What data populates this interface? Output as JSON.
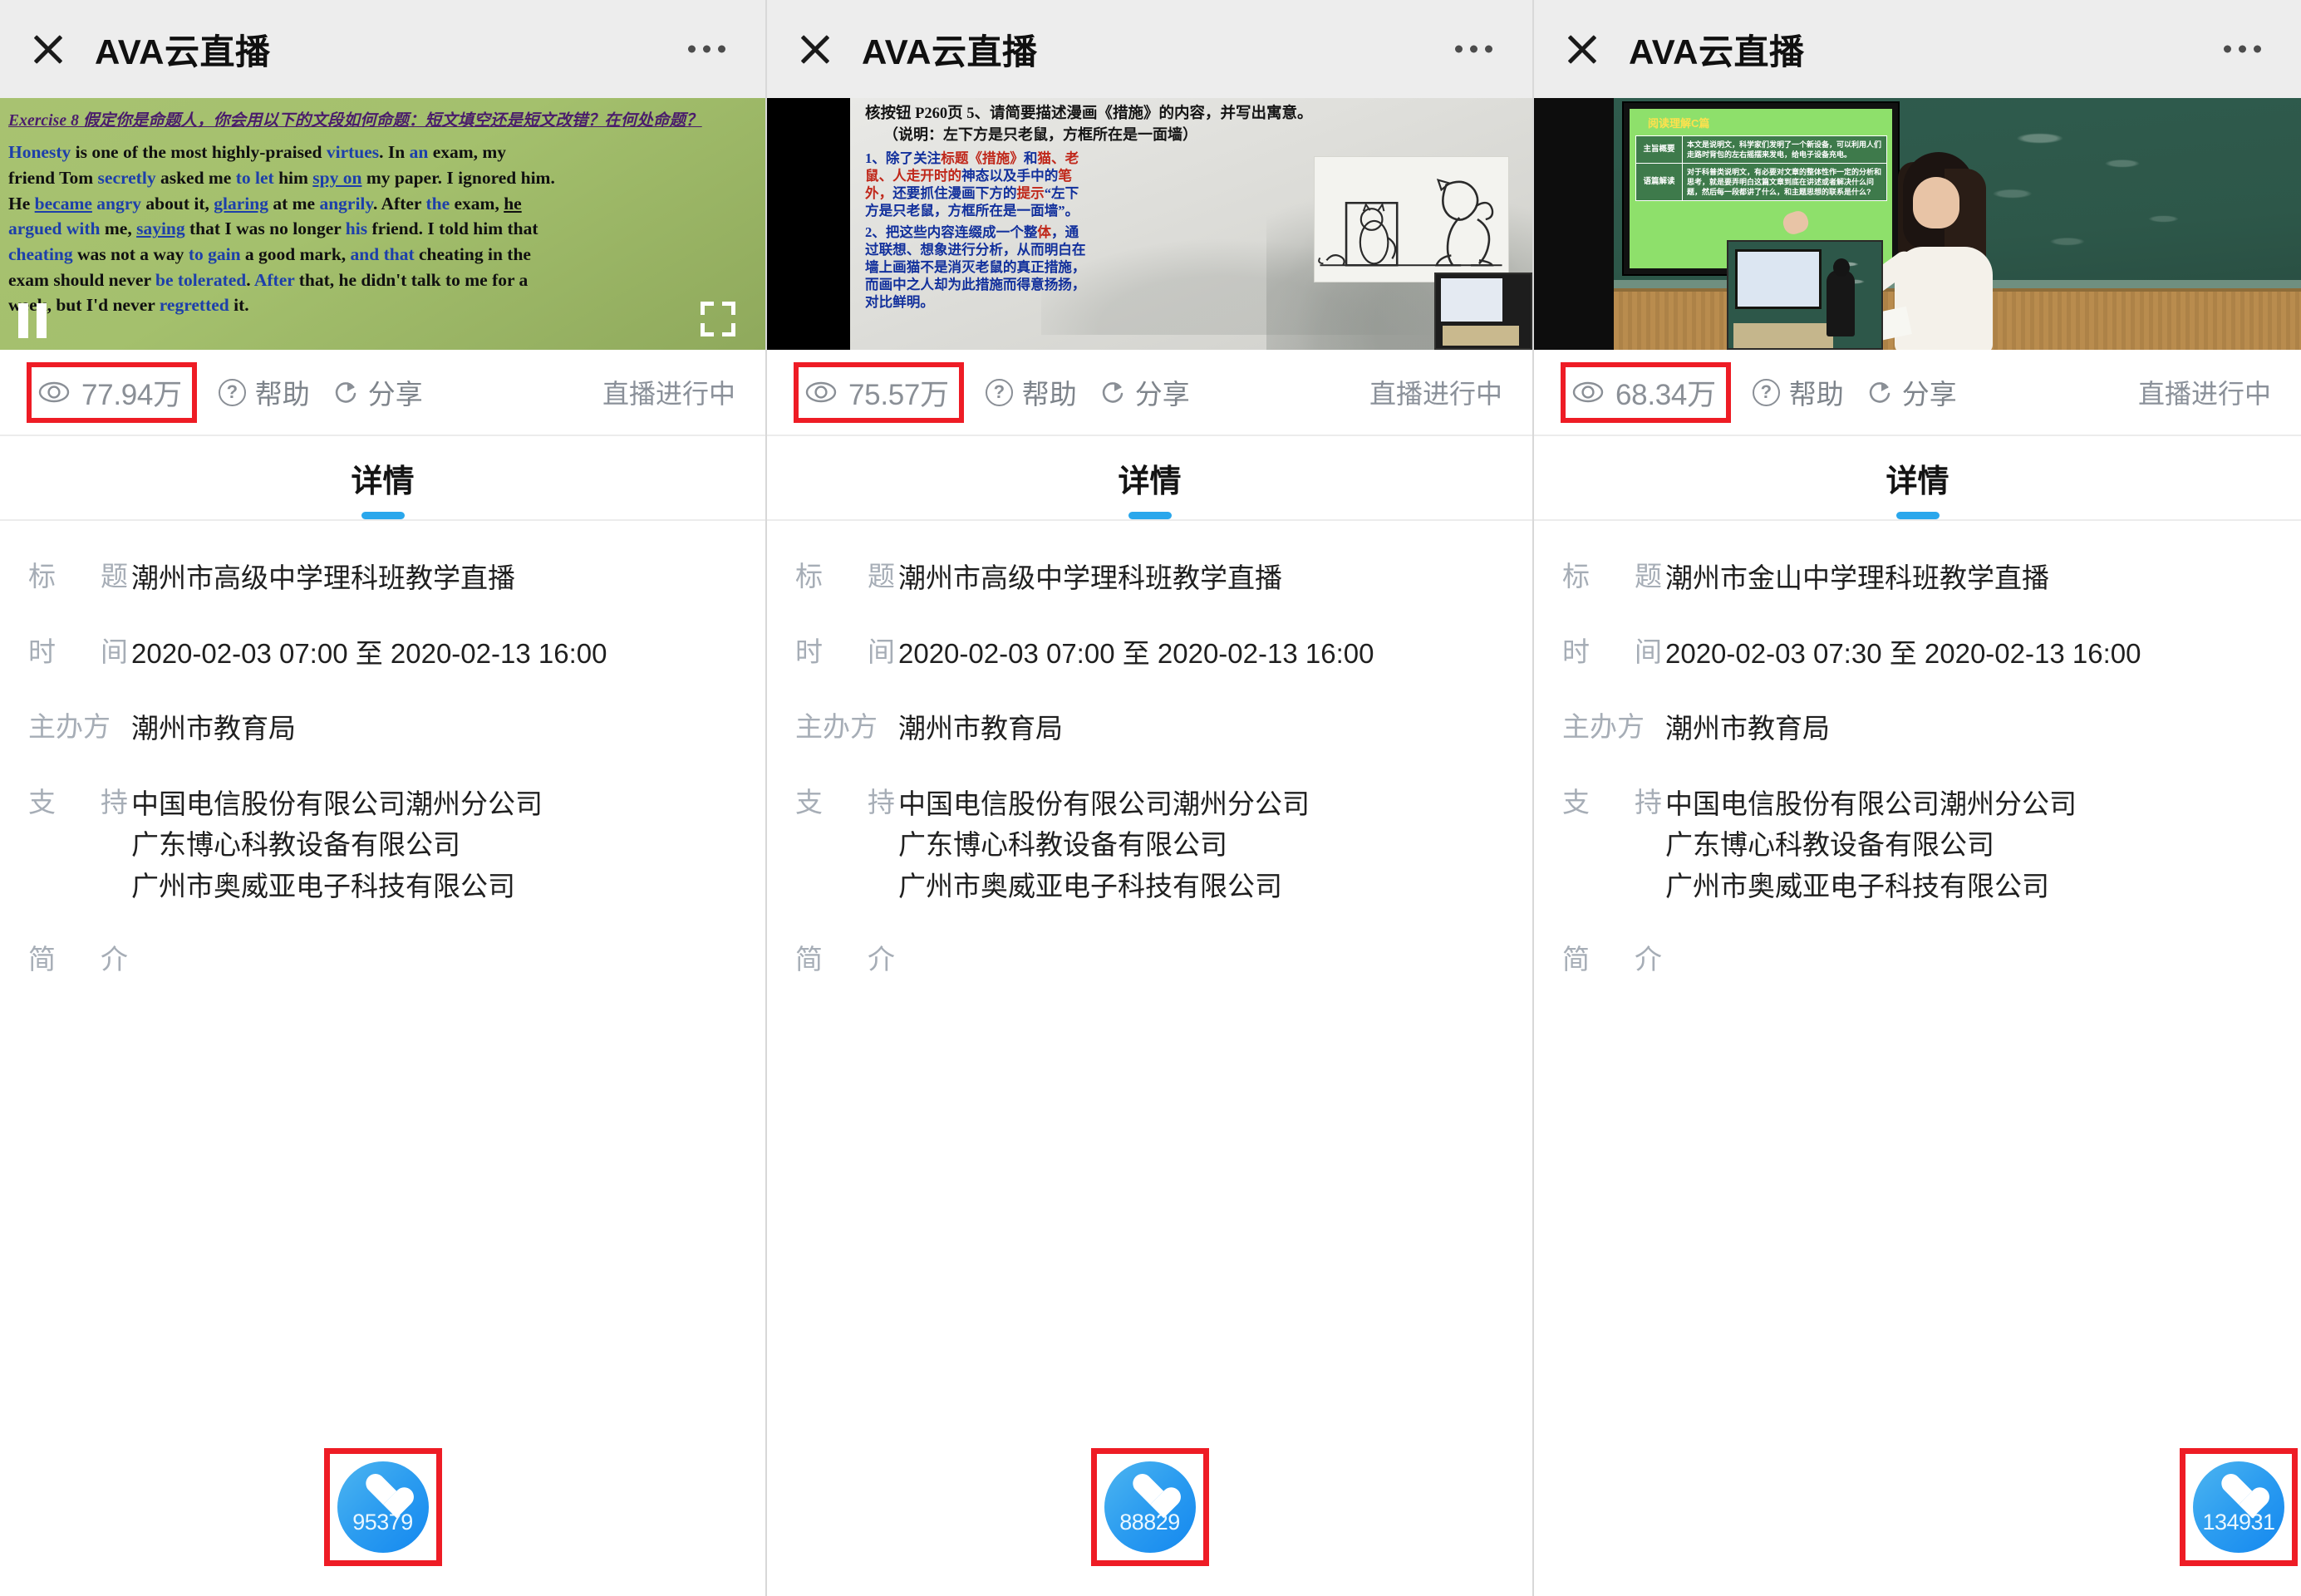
{
  "header": {
    "title": "AVA云直播",
    "close_icon": "close-icon",
    "more_icon": "more-options-icon"
  },
  "stats_common": {
    "help_label": "帮助",
    "share_label": "分享",
    "live_status": "直播进行中",
    "eye_icon": "eye-icon",
    "help_icon": "question-mark-icon",
    "share_icon": "share-icon"
  },
  "tab": {
    "label": "详情"
  },
  "info_keys": {
    "title": "标  题",
    "time": "时  间",
    "organizer": "主办方",
    "support": "支  持",
    "intro": "简  介"
  },
  "colors": {
    "accent_blue": "#2aa7ec",
    "highlight_red": "#ee1c25",
    "like_blue": "#2b9cf0",
    "muted_gray": "#a6adb6"
  },
  "panels": [
    {
      "views": "77.94万",
      "title": "潮州市高级中学理科班教学直播",
      "time": "2020-02-03 07:00 至 2020-02-13 16:00",
      "organizer": "潮州市教育局",
      "support": "中国电信股份有限公司潮州分公司\n广东博心科教设备有限公司\n广州市奥威亚电子科技有限公司",
      "intro": "",
      "like_count": "95379",
      "video": {
        "kind": "english-slide",
        "pause_icon": "pause-icon",
        "fullscreen_icon": "fullscreen-icon",
        "slide_heading": "Exercise 8  假定你是命题人，你会用以下的文段如何命题：短文填空还是短文改错？在何处命题？",
        "slide_lines": [
          "Honesty is one of the most highly-praised virtues. In an exam, my",
          "friend Tom secretly asked me to let him spy on my paper. I ignored him.",
          "He became angry about it, glaring at me angrily. After the exam, he",
          "argued with me, saying that I was no longer his friend. I told him that",
          "cheating was not a way to gain a good mark, and that cheating in the",
          "exam should never be tolerated. After that, he didn't talk to me for a",
          "week, but I'd never regretted it."
        ]
      }
    },
    {
      "views": "75.57万",
      "title": "潮州市高级中学理科班教学直播",
      "time": "2020-02-03 07:00 至 2020-02-13 16:00",
      "organizer": "潮州市教育局",
      "support": "中国电信股份有限公司潮州分公司\n广东博心科教设备有限公司\n广州市奥威亚电子科技有限公司",
      "intro": "",
      "like_count": "88829",
      "video": {
        "kind": "chinese-slide",
        "q_line1": "核按钮 P260页 5、请简要描述漫画《措施》的内容，并写出寓意。",
        "q_line2": "（说明：左下方是只老鼠，方框所在是一面墙）",
        "point1": "1、除了关注标题《措施》和猫、老鼠、人走开时的神态以及手中的笔外，还要抓住漫画下方的提示“左下方是只老鼠，方框所在是一面墙”。",
        "point2": "2、把这些内容连缀成一个整体，通过联想、想象进行分析，从而明白在墙上画猫不是消灭老鼠的真正措施，而画中之人却为此措施而得意扬扬，对比鲜明。",
        "cartoon_alt": "漫画：墙上画猫",
        "pip_alt": "教室画中画"
      }
    },
    {
      "views": "68.34万",
      "title": "潮州市金山中学理科班教学直播",
      "time": "2020-02-03 07:30 至 2020-02-13 16:00",
      "organizer": "潮州市教育局",
      "support": "中国电信股份有限公司潮州分公司\n广东博心科教设备有限公司\n广州市奥威亚电子科技有限公司",
      "intro": "",
      "like_count": "134931",
      "video": {
        "kind": "classroom",
        "screen_title": "阅读理解C篇",
        "table": [
          {
            "key": "主旨概要",
            "value": "本文是说明文，科学家们发明了一个新设备，可以利用人们走路时背包的左右摇摆来发电，给电子设备充电。"
          },
          {
            "key": "语篇解读",
            "value": "对于科普类说明文，有必要对文章的整体性作一定的分析和思考，就是要弄明白这篇文章到底在讲述或者解决什么问题，然后每一段都讲了什么，和主题思想的联系是什么?"
          }
        ],
        "teacher_alt": "教师指向投影屏幕",
        "pip_alt": "教室画中画"
      }
    }
  ]
}
